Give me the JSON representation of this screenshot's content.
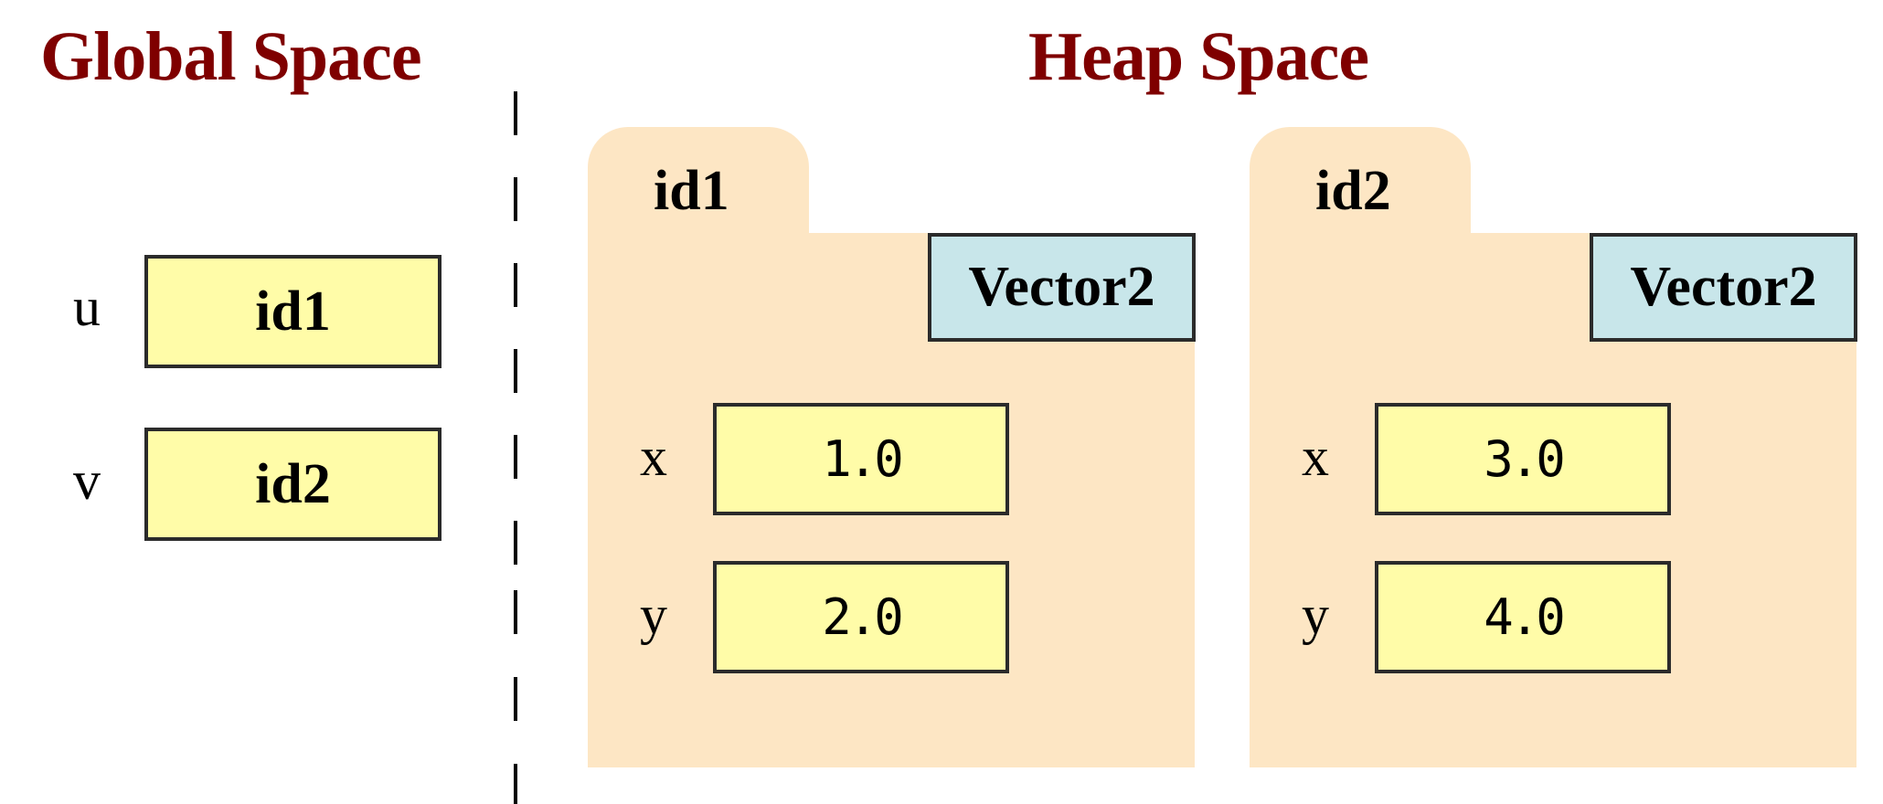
{
  "titles": {
    "global": "Global Space",
    "heap": "Heap Space"
  },
  "colors": {
    "title": "#7f0000",
    "frame_fill": "#fde6c4",
    "value_box_fill": "#fffca8",
    "class_box_fill": "#c8e6ea",
    "border": "#2b2b2b"
  },
  "global_vars": [
    {
      "name": "u",
      "value": "id1"
    },
    {
      "name": "v",
      "value": "id2"
    }
  ],
  "heap_objects": [
    {
      "id": "id1",
      "class": "Vector2",
      "fields": [
        {
          "name": "x",
          "value": "1.0"
        },
        {
          "name": "y",
          "value": "2.0"
        }
      ]
    },
    {
      "id": "id2",
      "class": "Vector2",
      "fields": [
        {
          "name": "x",
          "value": "3.0"
        },
        {
          "name": "y",
          "value": "4.0"
        }
      ]
    }
  ]
}
